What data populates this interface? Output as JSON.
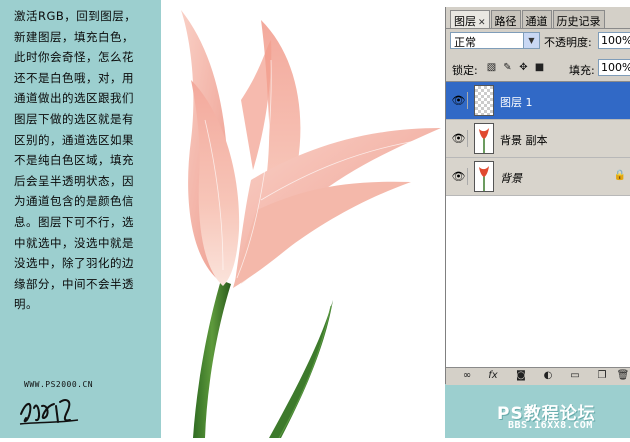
{
  "tutorial": {
    "paragraph": "激活RGB，回到图层，\n新建图层，填充白色，\n此时你会奇怪，怎么花\n还不是白色哦，对，用\n通道做出的选区跟我们\n图层下做的选区就是有\n区别的，通道选区如果\n不是纯白色区域，填充\n后会呈半透明状态，因\n为通道包含的是颜色信\n息。图层下可不行，选\n中就选中，没选中就是\n没选中，除了羽化的边\n缘部分，中间不会半透\n明。",
    "site": "WWW.PS2000.CN"
  },
  "panel": {
    "tabs": [
      {
        "label": "图层",
        "active": true
      },
      {
        "label": "路径",
        "active": false
      },
      {
        "label": "通道",
        "active": false
      },
      {
        "label": "历史记录",
        "active": false
      }
    ],
    "blend_mode": "正常",
    "opacity_label": "不透明度:",
    "opacity_value": "100%",
    "lock_label": "锁定:",
    "fill_label": "填充:",
    "fill_value": "100%",
    "layers": [
      {
        "name": "图层 1",
        "selected": true,
        "visible": true,
        "thumbnail": "transparent"
      },
      {
        "name": "背景 副本",
        "selected": false,
        "visible": true,
        "thumbnail": "tulip"
      },
      {
        "name": "背景",
        "selected": false,
        "visible": true,
        "thumbnail": "tulip",
        "locked": true
      }
    ],
    "bottom_icons": [
      "link-icon",
      "fx-icon",
      "mask-icon",
      "adjustment-icon",
      "folder-icon",
      "new-layer-icon",
      "trash-icon"
    ]
  },
  "watermark": {
    "title": "PS教程论坛",
    "url": "BBS.16XX8.COM"
  },
  "colors": {
    "text_panel_bg": "#9ccfcf",
    "selected_layer": "#3169c6",
    "panel_bg": "#d4d0c8"
  }
}
